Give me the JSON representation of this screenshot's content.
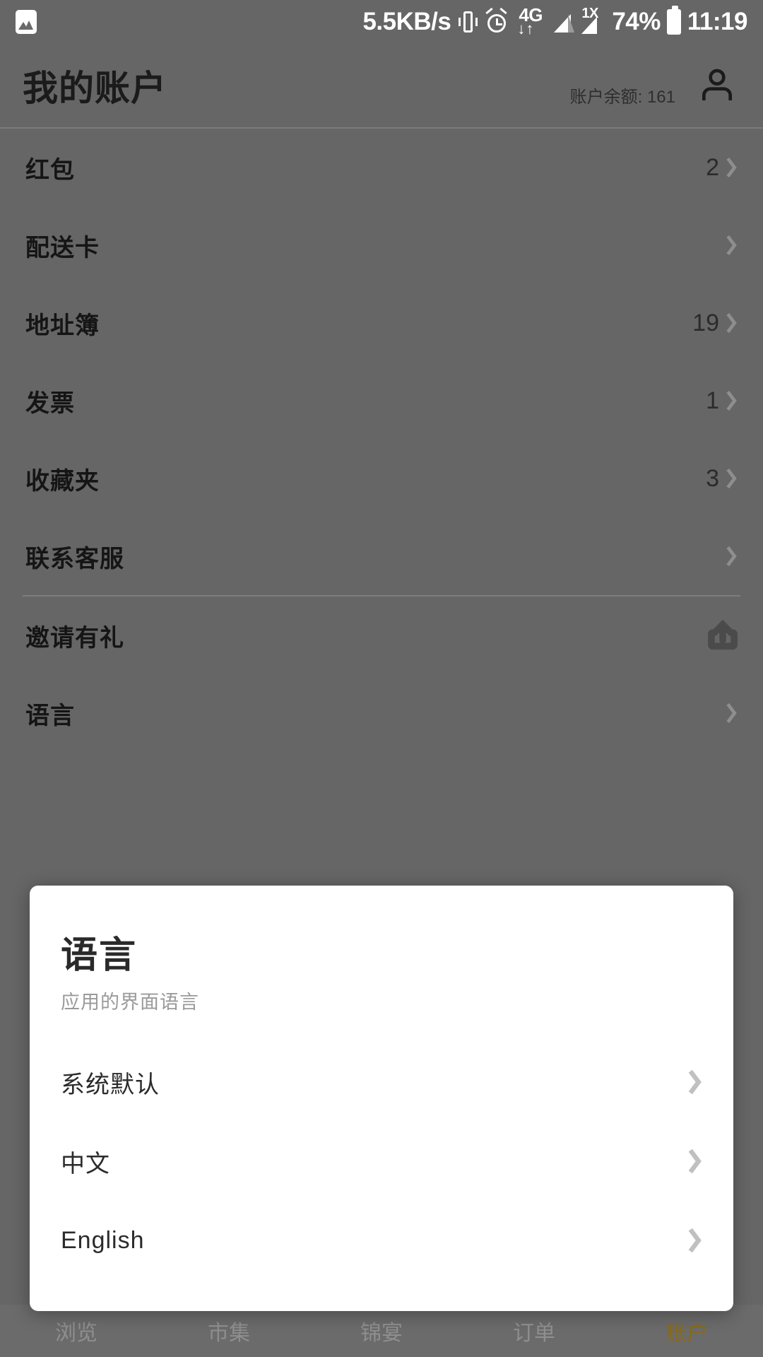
{
  "status_bar": {
    "photo_icon": "photo-icon",
    "network_speed": "5.5KB/s",
    "vibrate_icon": "vibrate-icon",
    "alarm_icon": "alarm-icon",
    "network_type": "4G",
    "network_arrows": "↓↑",
    "sim2_label": "1X",
    "battery_percent": "74%",
    "time": "11:19"
  },
  "header": {
    "title": "我的账户",
    "balance": "账户余额: 161",
    "avatar_icon": "person-icon"
  },
  "list": {
    "group1": [
      {
        "label": "红包",
        "count": "2",
        "chevron": "chevron-right-icon"
      },
      {
        "label": "配送卡",
        "count": "",
        "chevron": "chevron-right-icon"
      },
      {
        "label": "地址簿",
        "count": "19",
        "chevron": "chevron-right-icon"
      },
      {
        "label": "发票",
        "count": "1",
        "chevron": "chevron-right-icon"
      },
      {
        "label": "收藏夹",
        "count": "3",
        "chevron": "chevron-right-icon"
      },
      {
        "label": "联系客服",
        "count": "",
        "chevron": "chevron-right-icon"
      }
    ],
    "group2": [
      {
        "label": "邀请有礼",
        "count": "",
        "trailing_icon": "share-icon"
      },
      {
        "label": "语言",
        "count": "",
        "chevron": "chevron-right-icon"
      }
    ]
  },
  "dialog": {
    "title": "语言",
    "subtitle": "应用的界面语言",
    "options": [
      {
        "label": "系统默认",
        "chevron": "chevron-right-icon"
      },
      {
        "label": "中文",
        "chevron": "chevron-right-icon"
      },
      {
        "label": "English",
        "chevron": "chevron-right-icon"
      }
    ]
  },
  "bottom_nav": {
    "items": [
      {
        "label": "浏览",
        "active": false
      },
      {
        "label": "市集",
        "active": false
      },
      {
        "label": "锦宴",
        "active": false
      },
      {
        "label": "订单",
        "active": false
      },
      {
        "label": "账户",
        "active": true
      }
    ],
    "active_color": "#8a6a12"
  }
}
